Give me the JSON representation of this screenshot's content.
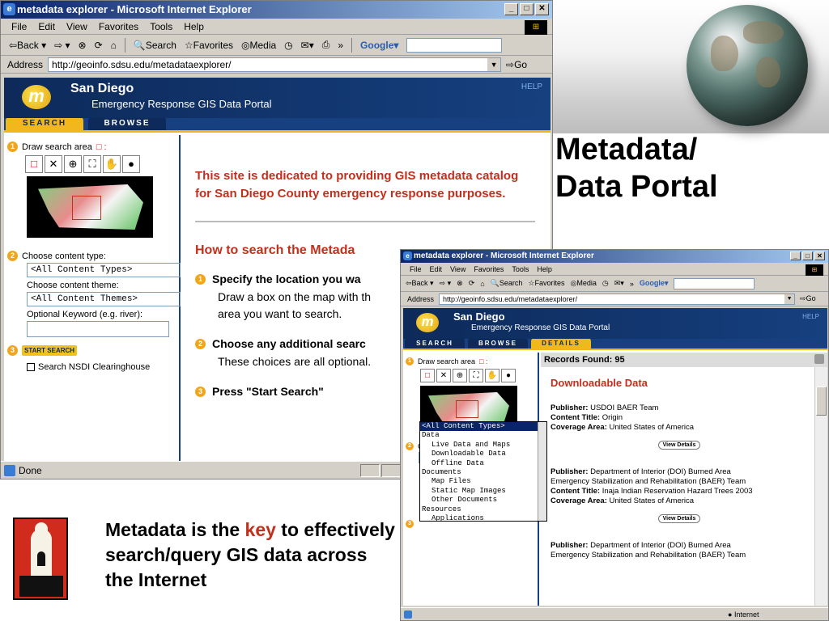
{
  "slide": {
    "title_line1": "Metadata/",
    "title_line2": "Data Portal",
    "caption_pre": "Metadata is the ",
    "caption_key": "key",
    "caption_post": " to effectively search/query GIS data across the Internet"
  },
  "browser": {
    "title": "metadata explorer - Microsoft Internet Explorer",
    "menu": [
      "File",
      "Edit",
      "View",
      "Favorites",
      "Tools",
      "Help"
    ],
    "toolbar": {
      "back": "⇦Back ▾",
      "forward": "⇨ ▾",
      "search": "Search",
      "favorites": "Favorites",
      "media": "Media",
      "google": "Google▾"
    },
    "address_label": "Address",
    "url": "http://geoinfo.sdsu.edu/metadataexplorer/",
    "go": "Go",
    "status": "Done",
    "status2": "Internet"
  },
  "portal": {
    "name": "San Diego",
    "subtitle": "Emergency Response GIS Data Portal",
    "help": "HELP",
    "tabs": [
      "SEARCH",
      "BROWSE",
      "DETAILS"
    ],
    "logo_letter": "m",
    "step1": "Draw search area",
    "step2": "Choose content type:",
    "content_type": "<All Content Types>",
    "theme_label": "Choose content theme:",
    "content_theme": "<All Content Themes>",
    "keyword_label": "Optional Keyword (e.g. river):",
    "start_search": "START SEARCH",
    "nsdi": "Search NSDI Clearinghouse",
    "intro": "This site is dedicated to providing GIS metadata catalog for San Diego County emergency response purposes.",
    "howto": "How to search the Metada",
    "how_steps": [
      {
        "num": "1",
        "title": "Specify the location you wa",
        "desc": "Draw a box on the map with th area you want to search."
      },
      {
        "num": "2",
        "title": "Choose any additional searc",
        "desc": "These choices are all optional."
      },
      {
        "num": "3",
        "title": "Press \"Start Search\"",
        "desc": ""
      }
    ]
  },
  "details": {
    "records_found": "Records Found: 95",
    "heading": "Downloadable Data",
    "view_details": "View Details",
    "records": [
      {
        "publisher": "USDOI BAER Team",
        "content_title": "Origin",
        "coverage": "United States of America"
      },
      {
        "publisher": "Department of Interior (DOI) Burned Area Emergency Stabilization and Rehabilitation (BAER) Team",
        "content_title": "Inaja Indian Reservation Hazard Trees 2003",
        "coverage": "United States of America"
      },
      {
        "publisher": "Department of Interior (DOI) Burned Area Emergency Stabilization and Rehabilitation (BAER) Team",
        "content_title": "",
        "coverage": ""
      }
    ],
    "labels": {
      "publisher": "Publisher:",
      "content_title": "Content Title:",
      "coverage": "Coverage Area:"
    },
    "dropdown": [
      {
        "text": "<All Content Types>",
        "level": 0,
        "highlight": true
      },
      {
        "text": "Data",
        "level": 0
      },
      {
        "text": "Live Data and Maps",
        "level": 1
      },
      {
        "text": "Downloadable Data",
        "level": 1
      },
      {
        "text": "Offline Data",
        "level": 1
      },
      {
        "text": "Documents",
        "level": 0
      },
      {
        "text": "Map Files",
        "level": 1
      },
      {
        "text": "Static Map Images",
        "level": 1
      },
      {
        "text": "Other Documents",
        "level": 1
      },
      {
        "text": "Resources",
        "level": 0
      },
      {
        "text": "Applications",
        "level": 1
      }
    ]
  },
  "colors": {
    "accent": "#c0301c",
    "navy": "#16407f",
    "gold": "#f1b71c"
  }
}
